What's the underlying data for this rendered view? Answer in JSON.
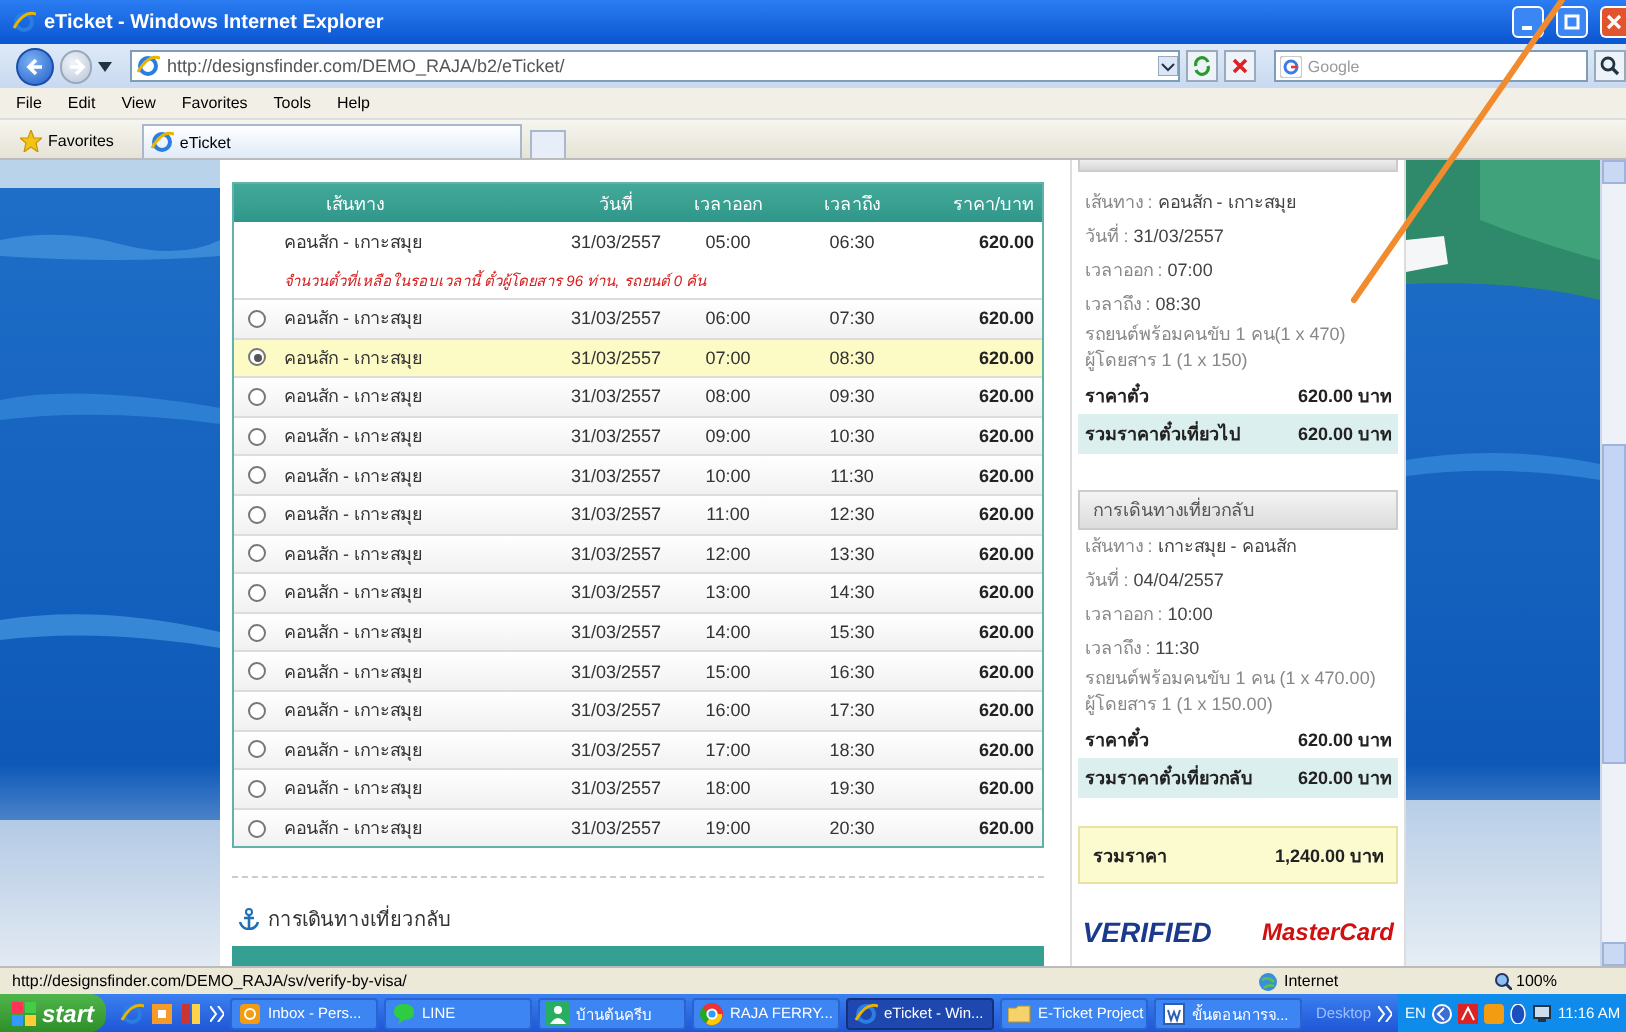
{
  "window": {
    "title": "eTicket - Windows Internet Explorer"
  },
  "toolbar": {
    "url": "http://designsfinder.com/DEMO_RAJA/b2/eTicket/",
    "search_placeholder": "Google"
  },
  "menu": [
    "File",
    "Edit",
    "View",
    "Favorites",
    "Tools",
    "Help"
  ],
  "favorites": {
    "label": "Favorites",
    "tabs": [
      {
        "label": "eTicket",
        "selected": true
      }
    ]
  },
  "outbound": {
    "columns": [
      "เส้นทาง",
      "วันที่",
      "เวลาออก",
      "เวลาถึง",
      "ราคา/บาท"
    ],
    "rows": [
      {
        "kind": "full",
        "route": "คอนสัก - เกาะสมุย",
        "date": "31/03/2557",
        "depart": "05:00",
        "arrive": "06:30",
        "price": "620.00",
        "selected": false,
        "note": "จำนวนตั๋วที่เหลือในรอบเวลานี้ ตั๋วผู้โดยสาร 96 ท่าน, รถยนต์ 0 คัน"
      },
      {
        "kind": "option",
        "route": "คอนสัก - เกาะสมุย",
        "date": "31/03/2557",
        "depart": "06:00",
        "arrive": "07:30",
        "price": "620.00",
        "selected": false
      },
      {
        "kind": "option",
        "route": "คอนสัก - เกาะสมุย",
        "date": "31/03/2557",
        "depart": "07:00",
        "arrive": "08:30",
        "price": "620.00",
        "selected": true
      },
      {
        "kind": "option",
        "route": "คอนสัก - เกาะสมุย",
        "date": "31/03/2557",
        "depart": "08:00",
        "arrive": "09:30",
        "price": "620.00",
        "selected": false
      },
      {
        "kind": "option",
        "route": "คอนสัก - เกาะสมุย",
        "date": "31/03/2557",
        "depart": "09:00",
        "arrive": "10:30",
        "price": "620.00",
        "selected": false
      },
      {
        "kind": "option",
        "route": "คอนสัก - เกาะสมุย",
        "date": "31/03/2557",
        "depart": "10:00",
        "arrive": "11:30",
        "price": "620.00",
        "selected": false
      },
      {
        "kind": "option",
        "route": "คอนสัก - เกาะสมุย",
        "date": "31/03/2557",
        "depart": "11:00",
        "arrive": "12:30",
        "price": "620.00",
        "selected": false
      },
      {
        "kind": "option",
        "route": "คอนสัก - เกาะสมุย",
        "date": "31/03/2557",
        "depart": "12:00",
        "arrive": "13:30",
        "price": "620.00",
        "selected": false
      },
      {
        "kind": "option",
        "route": "คอนสัก - เกาะสมุย",
        "date": "31/03/2557",
        "depart": "13:00",
        "arrive": "14:30",
        "price": "620.00",
        "selected": false
      },
      {
        "kind": "option",
        "route": "คอนสัก - เกาะสมุย",
        "date": "31/03/2557",
        "depart": "14:00",
        "arrive": "15:30",
        "price": "620.00",
        "selected": false
      },
      {
        "kind": "option",
        "route": "คอนสัก - เกาะสมุย",
        "date": "31/03/2557",
        "depart": "15:00",
        "arrive": "16:30",
        "price": "620.00",
        "selected": false
      },
      {
        "kind": "option",
        "route": "คอนสัก - เกาะสมุย",
        "date": "31/03/2557",
        "depart": "16:00",
        "arrive": "17:30",
        "price": "620.00",
        "selected": false
      },
      {
        "kind": "option",
        "route": "คอนสัก - เกาะสมุย",
        "date": "31/03/2557",
        "depart": "17:00",
        "arrive": "18:30",
        "price": "620.00",
        "selected": false
      },
      {
        "kind": "option",
        "route": "คอนสัก - เกาะสมุย",
        "date": "31/03/2557",
        "depart": "18:00",
        "arrive": "19:30",
        "price": "620.00",
        "selected": false
      },
      {
        "kind": "option",
        "route": "คอนสัก - เกาะสมุย",
        "date": "31/03/2557",
        "depart": "19:00",
        "arrive": "20:30",
        "price": "620.00",
        "selected": false
      }
    ]
  },
  "return_section": {
    "heading": "การเดินทางเที่ยวกลับ"
  },
  "summaries": [
    {
      "lines": [
        {
          "label": "เส้นทาง : ",
          "value": "คอนสัก - เกาะสมุย"
        },
        {
          "label": "วันที่ : ",
          "value": "31/03/2557"
        },
        {
          "label": "เวลาออก : ",
          "value": "07:00"
        },
        {
          "label": "เวลาถึง : ",
          "value": "08:30"
        }
      ],
      "details": [
        "รถยนต์พร้อมคนขับ 1 คน(1 x 470)",
        "ผู้โดยสาร 1 (1 x 150)"
      ],
      "fare_label": "ราคาตั๋ว",
      "fare": "620.00 บาท",
      "total_label": "รวมราคาตั๋วเที่ยวไป",
      "total": "620.00 บาท"
    },
    {
      "heading": "การเดินทางเที่ยวกลับ",
      "lines": [
        {
          "label": "เส้นทาง : ",
          "value": "เกาะสมุย - คอนสัก"
        },
        {
          "label": "วันที่ : ",
          "value": "04/04/2557"
        },
        {
          "label": "เวลาออก : ",
          "value": "10:00"
        },
        {
          "label": "เวลาถึง : ",
          "value": "11:30"
        }
      ],
      "details": [
        "รถยนต์พร้อมคนขับ 1 คน (1 x 470.00)",
        "ผู้โดยสาร 1 (1 x 150.00)"
      ],
      "fare_label": "ราคาตั๋ว",
      "fare": "620.00 บาท",
      "total_label": "รวมราคาตั๋วเที่ยวกลับ",
      "total": "620.00 บาท"
    }
  ],
  "grand_total": {
    "label": "รวมราคา",
    "value": "1,240.00 บาท"
  },
  "payment_logos": [
    {
      "kind": "visa",
      "text": "VERIFIED"
    },
    {
      "kind": "mastercard",
      "text": "MasterCard"
    }
  ],
  "status_bar": {
    "url": "http://designsfinder.com/DEMO_RAJA/sv/verify-by-visa/",
    "zone": "Internet",
    "zoom": "100%"
  },
  "taskbar": {
    "start": "start",
    "items": [
      {
        "kind": "mail",
        "label": "Inbox - Pers...",
        "selected": false
      },
      {
        "kind": "chat",
        "label": "LINE",
        "selected": false
      },
      {
        "kind": "person",
        "label": "บ้านต้นครีบ",
        "selected": false
      },
      {
        "kind": "browser",
        "label": "RAJA FERRY...",
        "selected": false
      },
      {
        "kind": "ie",
        "label": "eTicket - Win...",
        "selected": true
      },
      {
        "kind": "folder",
        "label": "E-Ticket Project",
        "selected": false
      },
      {
        "kind": "document",
        "label": "ขั้นตอนการจ...",
        "selected": false
      }
    ],
    "desktop": "Desktop",
    "language": "EN",
    "clock": "11:16 AM"
  }
}
